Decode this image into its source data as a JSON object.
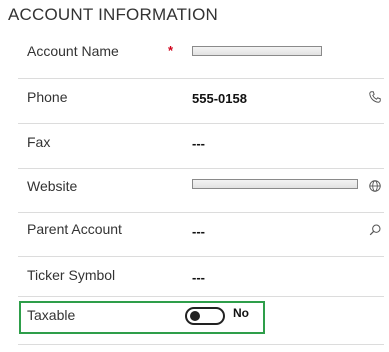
{
  "section": {
    "title": "ACCOUNT INFORMATION"
  },
  "fields": {
    "account_name": {
      "label": "Account Name",
      "required_mark": "*"
    },
    "phone": {
      "label": "Phone",
      "value": "555-0158",
      "icon": "phone-icon"
    },
    "fax": {
      "label": "Fax",
      "value": "---"
    },
    "website": {
      "label": "Website",
      "icon": "globe-icon"
    },
    "parent_account": {
      "label": "Parent Account",
      "value": "---",
      "icon": "search-icon"
    },
    "ticker_symbol": {
      "label": "Ticker Symbol",
      "value": "---"
    },
    "taxable": {
      "label": "Taxable",
      "toggle_text": "No",
      "toggle_on": false
    }
  },
  "colors": {
    "highlight": "#2e9e4a",
    "required": "#d0021b",
    "divider": "#dcdcdc"
  }
}
